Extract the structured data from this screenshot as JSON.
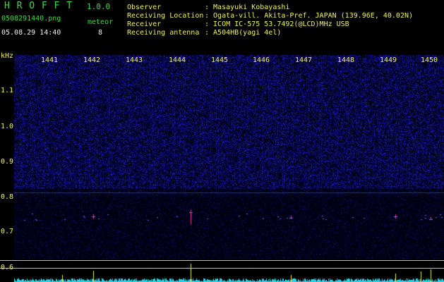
{
  "header": {
    "app_title": "H R O F F T",
    "app_version": "1.0.0",
    "filename": "0508291440.png",
    "meteor_label": "meteor",
    "datetime": "05.08.29 14:40",
    "meteor_count": "8"
  },
  "info": {
    "observer_label": "Observer",
    "observer_value": ": Masayuki Kobayashi",
    "location_label": "Receiving Location",
    "location_value": ": Ogata-vill. Akita-Pref. JAPAN (139.96E, 40.02N)",
    "receiver_label": "Receiver",
    "receiver_value": ": ICOM IC-575 53.7492(@LCD)MHz USB",
    "antenna_label": "Receiving antenna",
    "antenna_value": ": A504HB(yagi 4el)"
  },
  "axis": {
    "unit": "kHz",
    "y_ticks": [
      "1.1",
      "1.0",
      "0.9",
      "0.8",
      "0.7",
      "0.6"
    ],
    "x_ticks": [
      "1441",
      "1442",
      "1443",
      "1444",
      "1445",
      "1446",
      "1447",
      "1448",
      "1449",
      "1450"
    ]
  },
  "colors": {
    "background": "#000000",
    "label_green": "#3fdc3f",
    "axis_yellow": "#f2f25a",
    "spectrogram_blue": "#1a1aa8",
    "level_cyan": "#29d3e6"
  }
}
